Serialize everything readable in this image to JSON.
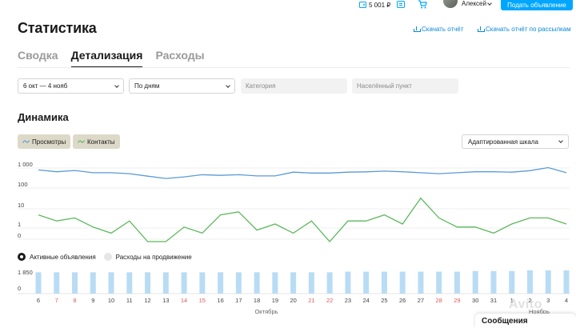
{
  "header": {
    "balance": "5 001 ₽",
    "user_name": "Алексей",
    "post_button": "Подать объявление"
  },
  "page": {
    "title": "Статистика",
    "download_report": "Скачать отчёт",
    "download_report_mailing": "Скачать отчёт по рассылкам"
  },
  "tabs": [
    {
      "label": "Сводка",
      "active": false
    },
    {
      "label": "Детализация",
      "active": true
    },
    {
      "label": "Расходы",
      "active": false
    }
  ],
  "filters": {
    "date_range": "6 окт — 4 нояб",
    "grouping": "По дням",
    "category_placeholder": "Категория",
    "location_placeholder": "Населённый пункт"
  },
  "dynamics": {
    "title": "Динамика",
    "views_label": "Просмотры",
    "contacts_label": "Контакты",
    "scale_select": "Адаптированная шкала",
    "views_color": "#5b9bd5",
    "contacts_color": "#5cb85c"
  },
  "toggles": {
    "active_ads": "Активные объявления",
    "promo_costs": "Расходы на продвижение"
  },
  "chart_data": [
    {
      "type": "line",
      "scale": "adaptive",
      "yticks": [
        "1 000",
        "100",
        "10",
        "1",
        "0"
      ],
      "x": [
        "6",
        "7",
        "8",
        "9",
        "10",
        "11",
        "12",
        "13",
        "14",
        "15",
        "16",
        "17",
        "18",
        "19",
        "20",
        "21",
        "22",
        "23",
        "24",
        "25",
        "26",
        "27",
        "28",
        "29",
        "30",
        "31",
        "1",
        "2",
        "3",
        "4"
      ],
      "series": [
        {
          "name": "Просмотры",
          "values": [
            800,
            650,
            750,
            580,
            580,
            520,
            390,
            300,
            360,
            460,
            430,
            460,
            400,
            400,
            620,
            560,
            560,
            620,
            640,
            700,
            650,
            580,
            520,
            580,
            650,
            650,
            620,
            740,
            1050,
            580
          ]
        },
        {
          "name": "Контакты",
          "values": [
            8,
            6,
            7,
            4,
            2,
            6,
            0,
            0,
            4,
            2,
            8,
            9,
            3,
            5,
            2,
            6,
            0,
            6,
            6,
            8,
            5,
            18,
            7,
            4,
            4,
            2,
            5,
            7,
            7,
            5
          ]
        }
      ]
    },
    {
      "type": "bar",
      "ylabel_ticks": [
        "1 850",
        "0"
      ],
      "x": [
        "6",
        "7",
        "8",
        "9",
        "10",
        "11",
        "12",
        "13",
        "14",
        "15",
        "16",
        "17",
        "18",
        "19",
        "20",
        "21",
        "22",
        "23",
        "24",
        "25",
        "26",
        "27",
        "28",
        "29",
        "30",
        "31",
        "1",
        "2",
        "3",
        "4"
      ],
      "weekend_days": [
        "7",
        "8",
        "14",
        "15",
        "21",
        "22",
        "28",
        "29"
      ],
      "xlabel": "Октябрь",
      "xlabel2": "Ноябрь",
      "values": [
        1700,
        1700,
        1700,
        1700,
        1700,
        1700,
        1700,
        1700,
        1700,
        1700,
        1700,
        1700,
        1700,
        1700,
        1700,
        1700,
        1700,
        1750,
        1750,
        1750,
        1750,
        1750,
        1750,
        1750,
        1800,
        1800,
        1800,
        1850,
        1850,
        1850
      ],
      "color": "#b9dcf5"
    }
  ],
  "widgets": {
    "messages": "Сообщения",
    "watermark": "Avito"
  }
}
